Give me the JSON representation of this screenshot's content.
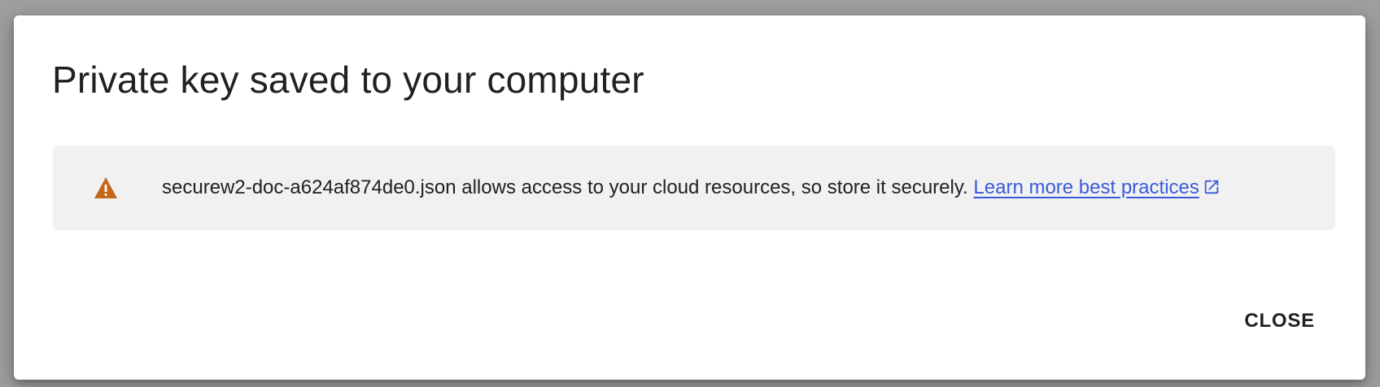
{
  "dialog": {
    "title": "Private key saved to your computer",
    "notice": {
      "icon": "warning-icon",
      "icon_color": "#c5671b",
      "message": "securew2-doc-a624af874de0.json allows access to your cloud resources, so store it securely.",
      "link_text": "Learn more best practices",
      "link_icon": "external-link-icon",
      "link_color": "#3b5bdb"
    },
    "close_label": "CLOSE"
  }
}
